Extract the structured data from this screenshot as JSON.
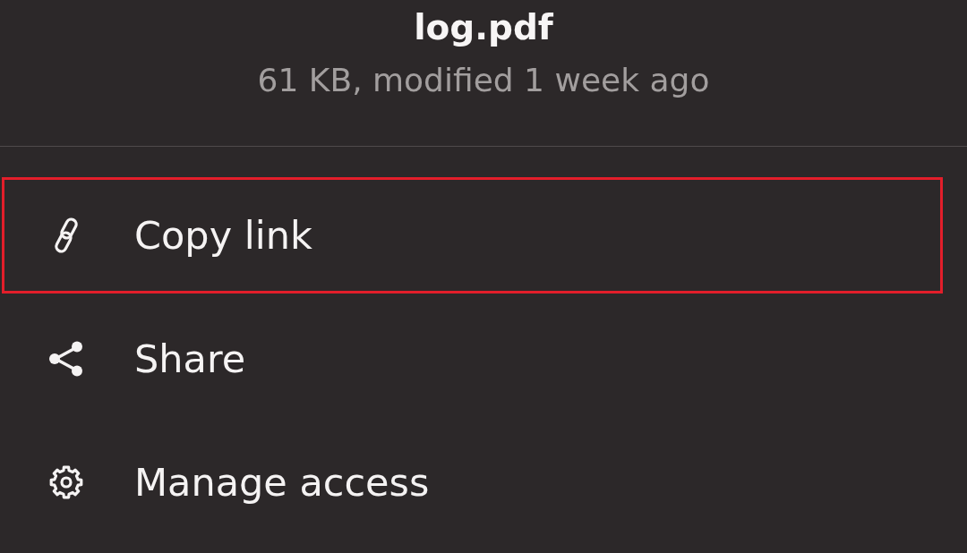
{
  "file": {
    "name": "log.pdf",
    "details": "61 KB, modified 1 week ago"
  },
  "menu": {
    "items": [
      {
        "kind": "link",
        "label": "Copy link",
        "highlighted": true
      },
      {
        "kind": "share",
        "label": "Share",
        "highlighted": false
      },
      {
        "kind": "settings",
        "label": "Manage access",
        "highlighted": false
      }
    ]
  }
}
